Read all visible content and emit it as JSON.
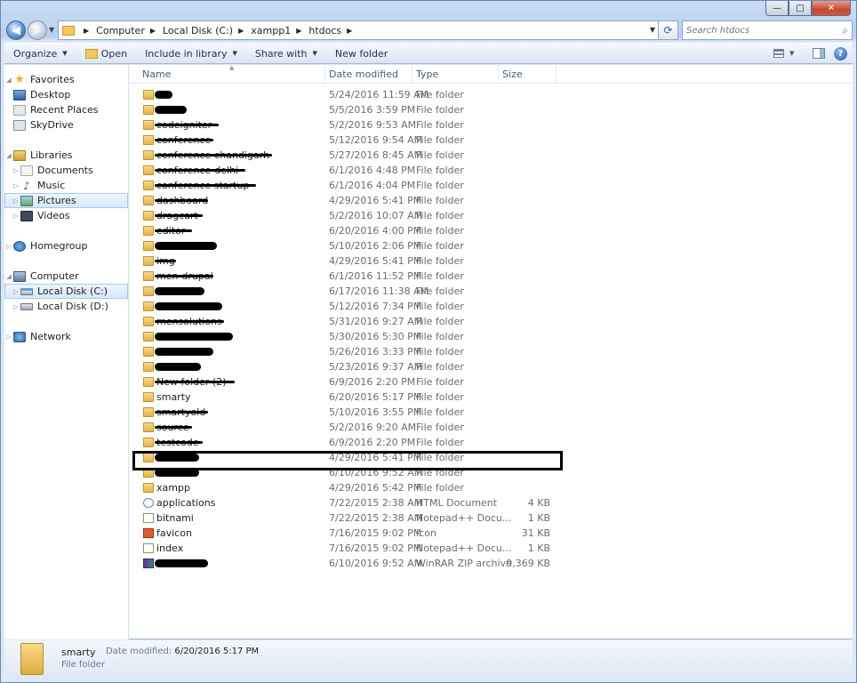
{
  "window": {
    "caption_min": "—",
    "caption_max": "□",
    "caption_close": "✕"
  },
  "address": {
    "crumbs": [
      "Computer",
      "Local Disk (C:)",
      "xampp1",
      "htdocs"
    ],
    "search_placeholder": "Search htdocs"
  },
  "toolbar": {
    "organize": "Organize",
    "open": "Open",
    "include": "Include in library",
    "share": "Share with",
    "new_folder": "New folder"
  },
  "nav": {
    "favorites": "Favorites",
    "desktop": "Desktop",
    "recent": "Recent Places",
    "skydrive": "SkyDrive",
    "libraries": "Libraries",
    "documents": "Documents",
    "music": "Music",
    "pictures": "Pictures",
    "videos": "Videos",
    "homegroup": "Homegroup",
    "computer": "Computer",
    "disk_c": "Local Disk (C:)",
    "disk_d": "Local Disk (D:)",
    "network": "Network"
  },
  "columns": {
    "name": "Name",
    "date": "Date modified",
    "type": "Type",
    "size": "Size"
  },
  "files": [
    {
      "name": "",
      "date": "5/24/2016 11:59 AM",
      "type": "File folder",
      "size": "",
      "icon": "folder"
    },
    {
      "name": "",
      "date": "5/5/2016 3:59 PM",
      "type": "File folder",
      "size": "",
      "icon": "folder"
    },
    {
      "name": "codeigniter",
      "date": "5/2/2016 9:53 AM",
      "type": "File folder",
      "size": "",
      "icon": "folder"
    },
    {
      "name": "conference",
      "date": "5/12/2016 9:54 AM",
      "type": "File folder",
      "size": "",
      "icon": "folder"
    },
    {
      "name": "conference-chandigarh",
      "date": "5/27/2016 8:45 AM",
      "type": "File folder",
      "size": "",
      "icon": "folder"
    },
    {
      "name": "conference-delhi",
      "date": "6/1/2016 4:48 PM",
      "type": "File folder",
      "size": "",
      "icon": "folder"
    },
    {
      "name": "conference startup",
      "date": "6/1/2016 4:04 PM",
      "type": "File folder",
      "size": "",
      "icon": "folder"
    },
    {
      "name": "dashboard",
      "date": "4/29/2016 5:41 PM",
      "type": "File folder",
      "size": "",
      "icon": "folder"
    },
    {
      "name": "dragcart",
      "date": "5/2/2016 10:07 AM",
      "type": "File folder",
      "size": "",
      "icon": "folder"
    },
    {
      "name": "editor",
      "date": "6/20/2016 4:00 PM",
      "type": "File folder",
      "size": "",
      "icon": "folder"
    },
    {
      "name": "",
      "date": "5/10/2016 2:06 PM",
      "type": "File folder",
      "size": "",
      "icon": "folder"
    },
    {
      "name": "img",
      "date": "4/29/2016 5:41 PM",
      "type": "File folder",
      "size": "",
      "icon": "folder"
    },
    {
      "name": "men-drupal",
      "date": "6/1/2016 11:52 PM",
      "type": "File folder",
      "size": "",
      "icon": "folder"
    },
    {
      "name": "",
      "date": "6/17/2016 11:38 AM",
      "type": "File folder",
      "size": "",
      "icon": "folder"
    },
    {
      "name": "",
      "date": "5/12/2016 7:34 PM",
      "type": "File folder",
      "size": "",
      "icon": "folder"
    },
    {
      "name": "mensolutions",
      "date": "5/31/2016 9:27 AM",
      "type": "File folder",
      "size": "",
      "icon": "folder"
    },
    {
      "name": "",
      "date": "5/30/2016 5:30 PM",
      "type": "File folder",
      "size": "",
      "icon": "folder"
    },
    {
      "name": "",
      "date": "5/26/2016 3:33 PM",
      "type": "File folder",
      "size": "",
      "icon": "folder"
    },
    {
      "name": "",
      "date": "5/23/2016 9:37 AM",
      "type": "File folder",
      "size": "",
      "icon": "folder"
    },
    {
      "name": "New folder (2)",
      "date": "6/9/2016 2:20 PM",
      "type": "File folder",
      "size": "",
      "icon": "folder"
    },
    {
      "name": "smarty",
      "date": "6/20/2016 5:17 PM",
      "type": "File folder",
      "size": "",
      "icon": "folder"
    },
    {
      "name": "smartyold",
      "date": "5/10/2016 3:55 PM",
      "type": "File folder",
      "size": "",
      "icon": "folder"
    },
    {
      "name": "source",
      "date": "5/2/2016 9:20 AM",
      "type": "File folder",
      "size": "",
      "icon": "folder"
    },
    {
      "name": "testcode",
      "date": "6/9/2016 2:20 PM",
      "type": "File folder",
      "size": "",
      "icon": "folder"
    },
    {
      "name": "",
      "date": "4/29/2016 5:41 PM",
      "type": "File folder",
      "size": "",
      "icon": "folder"
    },
    {
      "name": "",
      "date": "6/10/2016 9:52 AM",
      "type": "File folder",
      "size": "",
      "icon": "folder"
    },
    {
      "name": "xampp",
      "date": "4/29/2016 5:42 PM",
      "type": "File folder",
      "size": "",
      "icon": "folder"
    },
    {
      "name": "applications",
      "date": "7/22/2015 2:38 AM",
      "type": "HTML Document",
      "size": "4 KB",
      "icon": "html"
    },
    {
      "name": "bitnami",
      "date": "7/22/2015 2:38 AM",
      "type": "Notepad++ Docu...",
      "size": "1 KB",
      "icon": "npp"
    },
    {
      "name": "favicon",
      "date": "7/16/2015 9:02 PM",
      "type": "Icon",
      "size": "31 KB",
      "icon": "icon"
    },
    {
      "name": "index",
      "date": "7/16/2015 9:02 PM",
      "type": "Notepad++ Docu...",
      "size": "1 KB",
      "icon": "npp"
    },
    {
      "name": "",
      "date": "6/10/2016 9:52 AM",
      "type": "WinRAR ZIP archive",
      "size": "9,369 KB",
      "icon": "rar"
    }
  ],
  "details": {
    "name": "smarty",
    "date_label": "Date modified:",
    "date_value": "6/20/2016 5:17 PM",
    "type": "File folder"
  }
}
